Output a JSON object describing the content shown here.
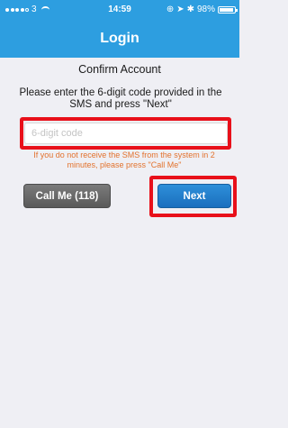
{
  "status_bar": {
    "carrier": "3",
    "time": "14:59",
    "battery": "98%"
  },
  "nav": {
    "title": "Login"
  },
  "content": {
    "section_title": "Confirm Account",
    "instructions": "Please enter the 6-digit code provided in the SMS and press \"Next\"",
    "code_input": {
      "placeholder": "6-digit code",
      "value": ""
    },
    "hint": "If you do not receive the SMS from the system in 2 minutes, please press \"Call Me\""
  },
  "buttons": {
    "call_me": "Call Me (118)",
    "next": "Next"
  },
  "colors": {
    "accent": "#2d9ee0",
    "highlight": "#e8101a",
    "hint": "#e2732e",
    "call_button": "#6a6a6a",
    "next_button": "#1e7dcb"
  }
}
